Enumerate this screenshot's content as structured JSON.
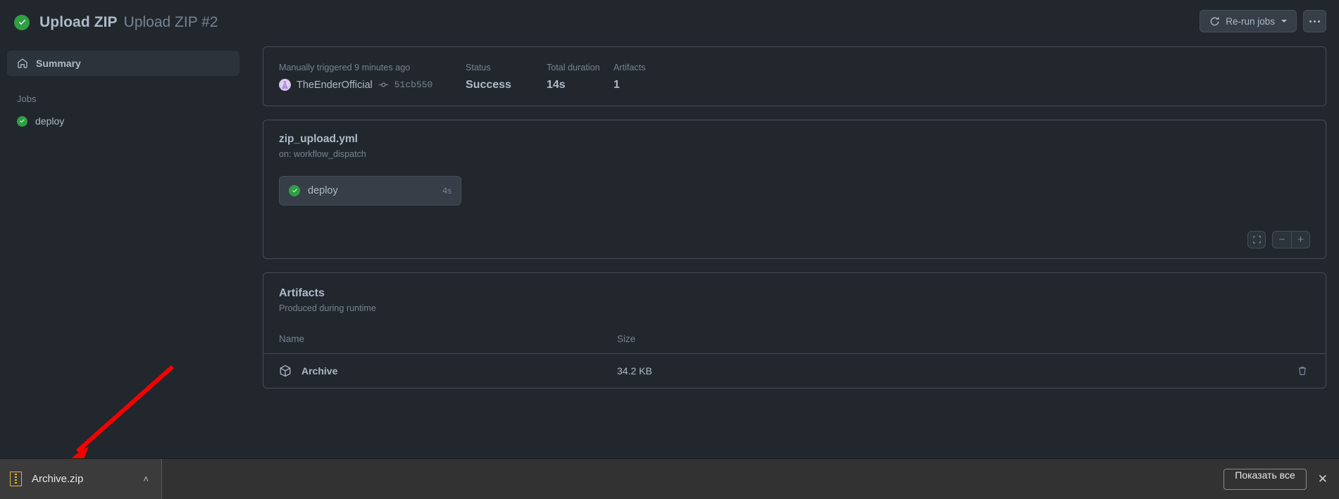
{
  "header": {
    "status_icon": "check-circle-icon",
    "title": "Upload ZIP",
    "subtitle": "Upload ZIP #2",
    "rerun_label": "Re-run jobs",
    "rerun_icon": "refresh-icon",
    "kebab_icon": "kebab-horizontal-icon"
  },
  "sidebar": {
    "summary_label": "Summary",
    "summary_icon": "home-icon",
    "jobs_heading": "Jobs",
    "jobs": [
      {
        "label": "deploy",
        "status": "success"
      }
    ]
  },
  "summary": {
    "trigger_label": "Manually triggered 9 minutes ago",
    "actor": "TheEnderOfficial",
    "commit_icon": "commit-icon",
    "commit_sha": "51cb550",
    "status_label": "Status",
    "status_value": "Success",
    "duration_label": "Total duration",
    "duration_value": "14s",
    "artifacts_label": "Artifacts",
    "artifacts_value": "1"
  },
  "workflow": {
    "file": "zip_upload.yml",
    "trigger": "on: workflow_dispatch",
    "node": {
      "label": "deploy",
      "time": "4s",
      "status": "success"
    },
    "controls": {
      "fit_icon": "fit-screen-icon",
      "zoom_out": "−",
      "zoom_in": "+"
    }
  },
  "artifacts": {
    "title": "Artifacts",
    "subtitle": "Produced during runtime",
    "columns": [
      "Name",
      "Size"
    ],
    "rows": [
      {
        "name": "Archive",
        "size": "34.2 KB",
        "icon": "package-icon",
        "delete_icon": "trash-icon"
      }
    ]
  },
  "download_bar": {
    "file_name": "Archive.zip",
    "file_icon": "zip-file-icon",
    "chevron": "˄",
    "show_all_label": "Показать все",
    "close": "✕"
  },
  "annotation": {
    "arrow_color": "#f80000"
  },
  "colors": {
    "page_bg": "#22272e",
    "card_border": "#444c56",
    "success_green": "#2ea043",
    "text_primary": "#adbac7",
    "text_muted": "#768390",
    "zip_yellow": "#e8b339",
    "downloadbar_bg": "#323232"
  }
}
